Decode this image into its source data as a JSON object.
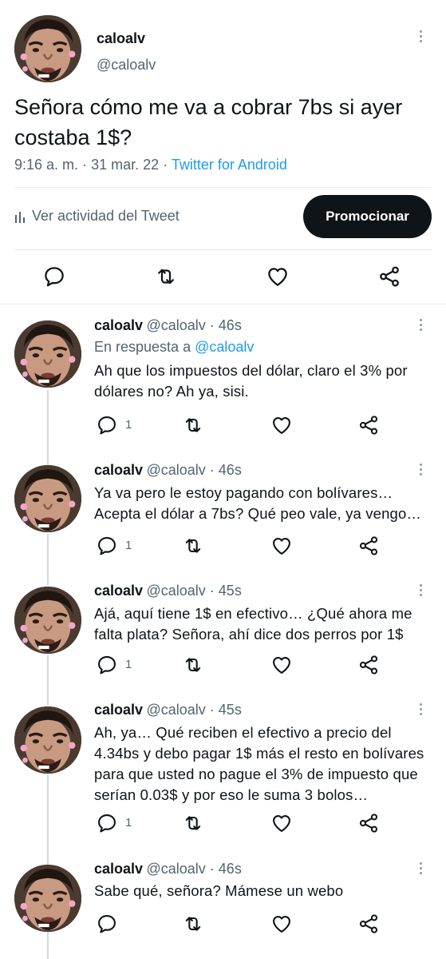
{
  "main_tweet": {
    "name": "caloalv",
    "handle": "@caloalv",
    "text_line1": "Señora cómo me va a cobrar 7bs si ayer",
    "text_line2": "costaba 1$?",
    "time": "9:16 a. m.",
    "date": "31 mar. 22",
    "source": "Twitter for Android",
    "sep1": "·",
    "sep2": "·",
    "activity_label": "Ver actividad del Tweet",
    "promote_label": "Promocionar"
  },
  "replies": [
    {
      "name": "caloalv",
      "handle_time": "@caloalv · 46s",
      "reply_to_prefix": "En respuesta a",
      "reply_to_handle": "@caloalv",
      "lines": [
        "Ah que los impuestos del dólar, claro el 3% por",
        "dólares no? Ah ya, sisi."
      ],
      "reply_count": "1"
    },
    {
      "name": "caloalv",
      "handle_time": "@caloalv · 46s",
      "lines": [
        "Ya va pero le estoy pagando con bolívares…",
        "Acepta el dólar a 7bs? Qué peo vale, ya vengo…"
      ],
      "reply_count": "1"
    },
    {
      "name": "caloalv",
      "handle_time": "@caloalv · 45s",
      "lines": [
        "Ajá, aquí tiene 1$ en efectivo… ¿Qué ahora me",
        "falta plata? Señora, ahí dice dos perros por 1$"
      ],
      "reply_count": "1"
    },
    {
      "name": "caloalv",
      "handle_time": "@caloalv · 45s",
      "lines": [
        "Ah, ya… Qué reciben el efectivo a precio del",
        "4.34bs y debo pagar 1$ más el resto en bolívares",
        "para que usted no pague el 3% de impuesto que",
        "serían 0.03$ y por eso le suma 3 bolos…"
      ],
      "reply_count": "1"
    },
    {
      "name": "caloalv",
      "handle_time": "@caloalv · 46s",
      "lines": [
        "Sabe qué, señora? Mámese un webo"
      ],
      "reply_count": ""
    }
  ],
  "icons": {
    "reply": "speech-bubble-icon",
    "retweet": "retweet-icon",
    "like": "heart-icon",
    "share": "share-icon",
    "more": "more-vertical-icon",
    "activity": "bar-chart-icon"
  },
  "colors": {
    "text": "#0f1419",
    "muted": "#536471",
    "link": "#1d9bf0",
    "button_bg": "#0f1419"
  }
}
